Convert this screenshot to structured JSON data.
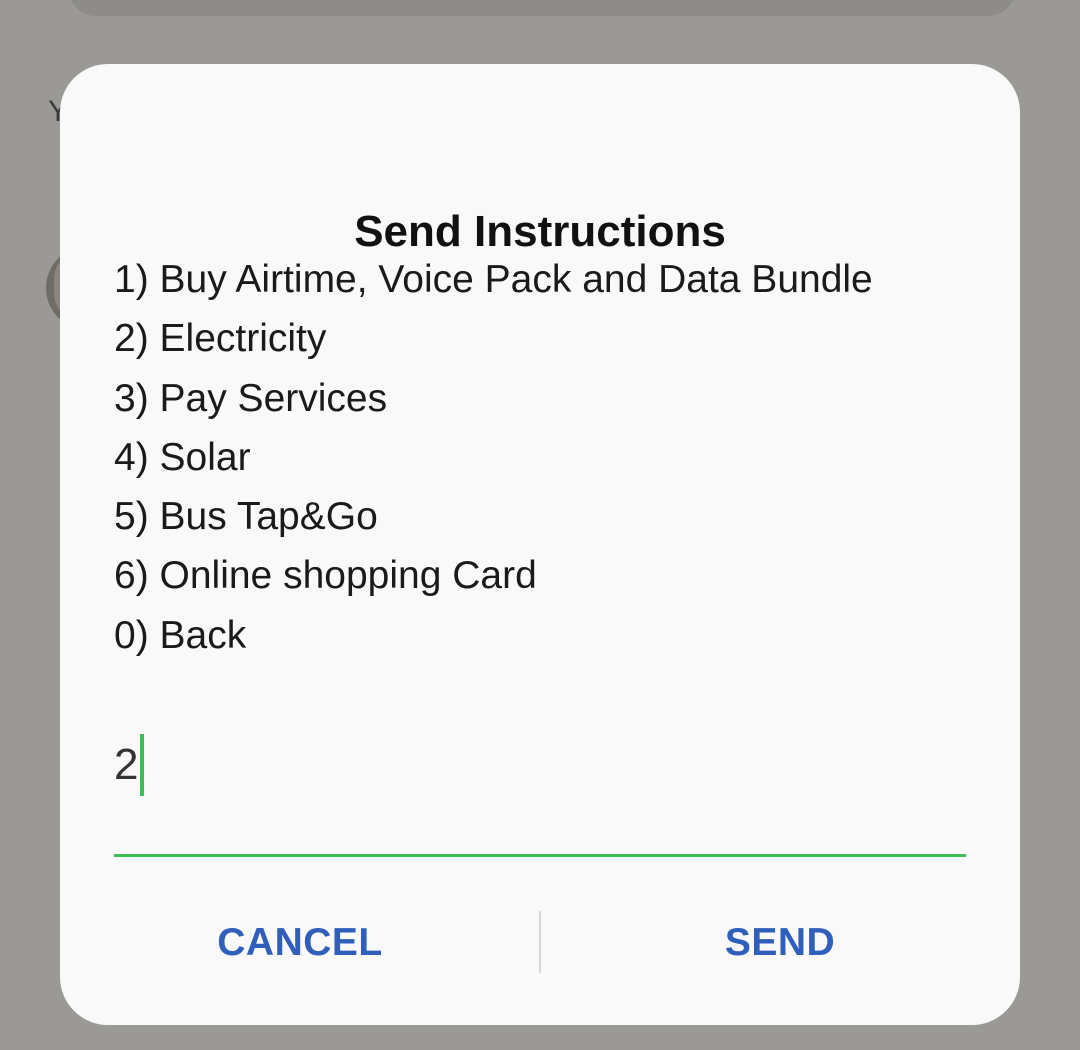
{
  "background": {
    "partial_letter": "Y"
  },
  "dialog": {
    "title": "Send Instructions",
    "menu_items": [
      "1) Buy Airtime, Voice Pack and Data Bundle",
      "2) Electricity",
      "3) Pay Services",
      "4) Solar",
      "5) Bus Tap&Go",
      "6) Online shopping Card",
      "0) Back"
    ],
    "input": {
      "value": "2"
    },
    "buttons": {
      "cancel_label": "CANCEL",
      "send_label": "SEND"
    }
  },
  "colors": {
    "accent_green": "#3cbd55",
    "button_blue": "#2f5fba",
    "dialog_bg": "#f9f9f9",
    "scrim": "#9a9995"
  }
}
